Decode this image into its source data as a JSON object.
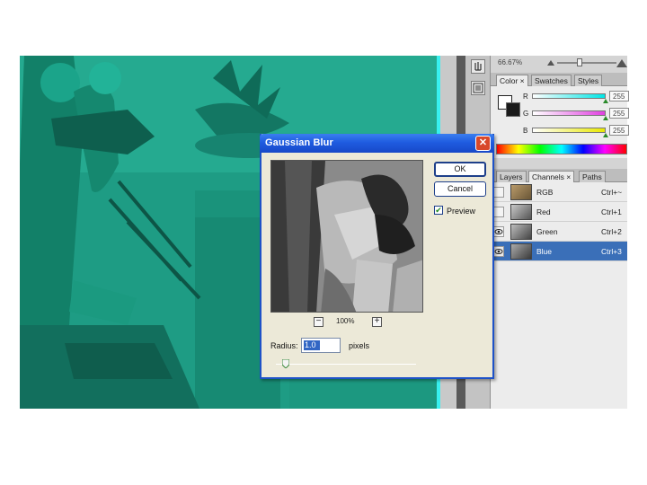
{
  "canvas": {
    "tint": "#1f9f86",
    "edge_color": "#38f0f0"
  },
  "tool_strip": {
    "buttons": [
      "hand-icon",
      "history-icon"
    ]
  },
  "panels": {
    "zoom_bar": {
      "percent": "66.67%"
    },
    "color_panel": {
      "tabs": [
        {
          "label": "Color ×",
          "active": true
        },
        {
          "label": "Swatches",
          "active": false
        },
        {
          "label": "Styles",
          "active": false
        }
      ],
      "channels": [
        {
          "letter": "R",
          "value": "255",
          "color": "#00e5e5"
        },
        {
          "letter": "G",
          "value": "255",
          "color": "#e040e0"
        },
        {
          "letter": "B",
          "value": "255",
          "color": "#e8e800"
        }
      ]
    },
    "channels_panel": {
      "tabs": [
        {
          "label": "Layers",
          "active": false
        },
        {
          "label": "Channels ×",
          "active": true
        },
        {
          "label": "Paths",
          "active": false
        }
      ],
      "rows": [
        {
          "name": "RGB",
          "shortcut": "Ctrl+~",
          "visible": false,
          "selected": false
        },
        {
          "name": "Red",
          "shortcut": "Ctrl+1",
          "visible": false,
          "selected": false
        },
        {
          "name": "Green",
          "shortcut": "Ctrl+2",
          "visible": true,
          "selected": false
        },
        {
          "name": "Blue",
          "shortcut": "Ctrl+3",
          "visible": true,
          "selected": true
        }
      ]
    }
  },
  "dialog": {
    "title": "Gaussian Blur",
    "ok_label": "OK",
    "cancel_label": "Cancel",
    "preview_label": "Preview",
    "preview_checked": true,
    "zoom_level": "100%",
    "zoom_out": "−",
    "zoom_in": "+",
    "radius_label": "Radius:",
    "radius_value": "1.0",
    "unit_label": "pixels",
    "close_glyph": "✕"
  }
}
